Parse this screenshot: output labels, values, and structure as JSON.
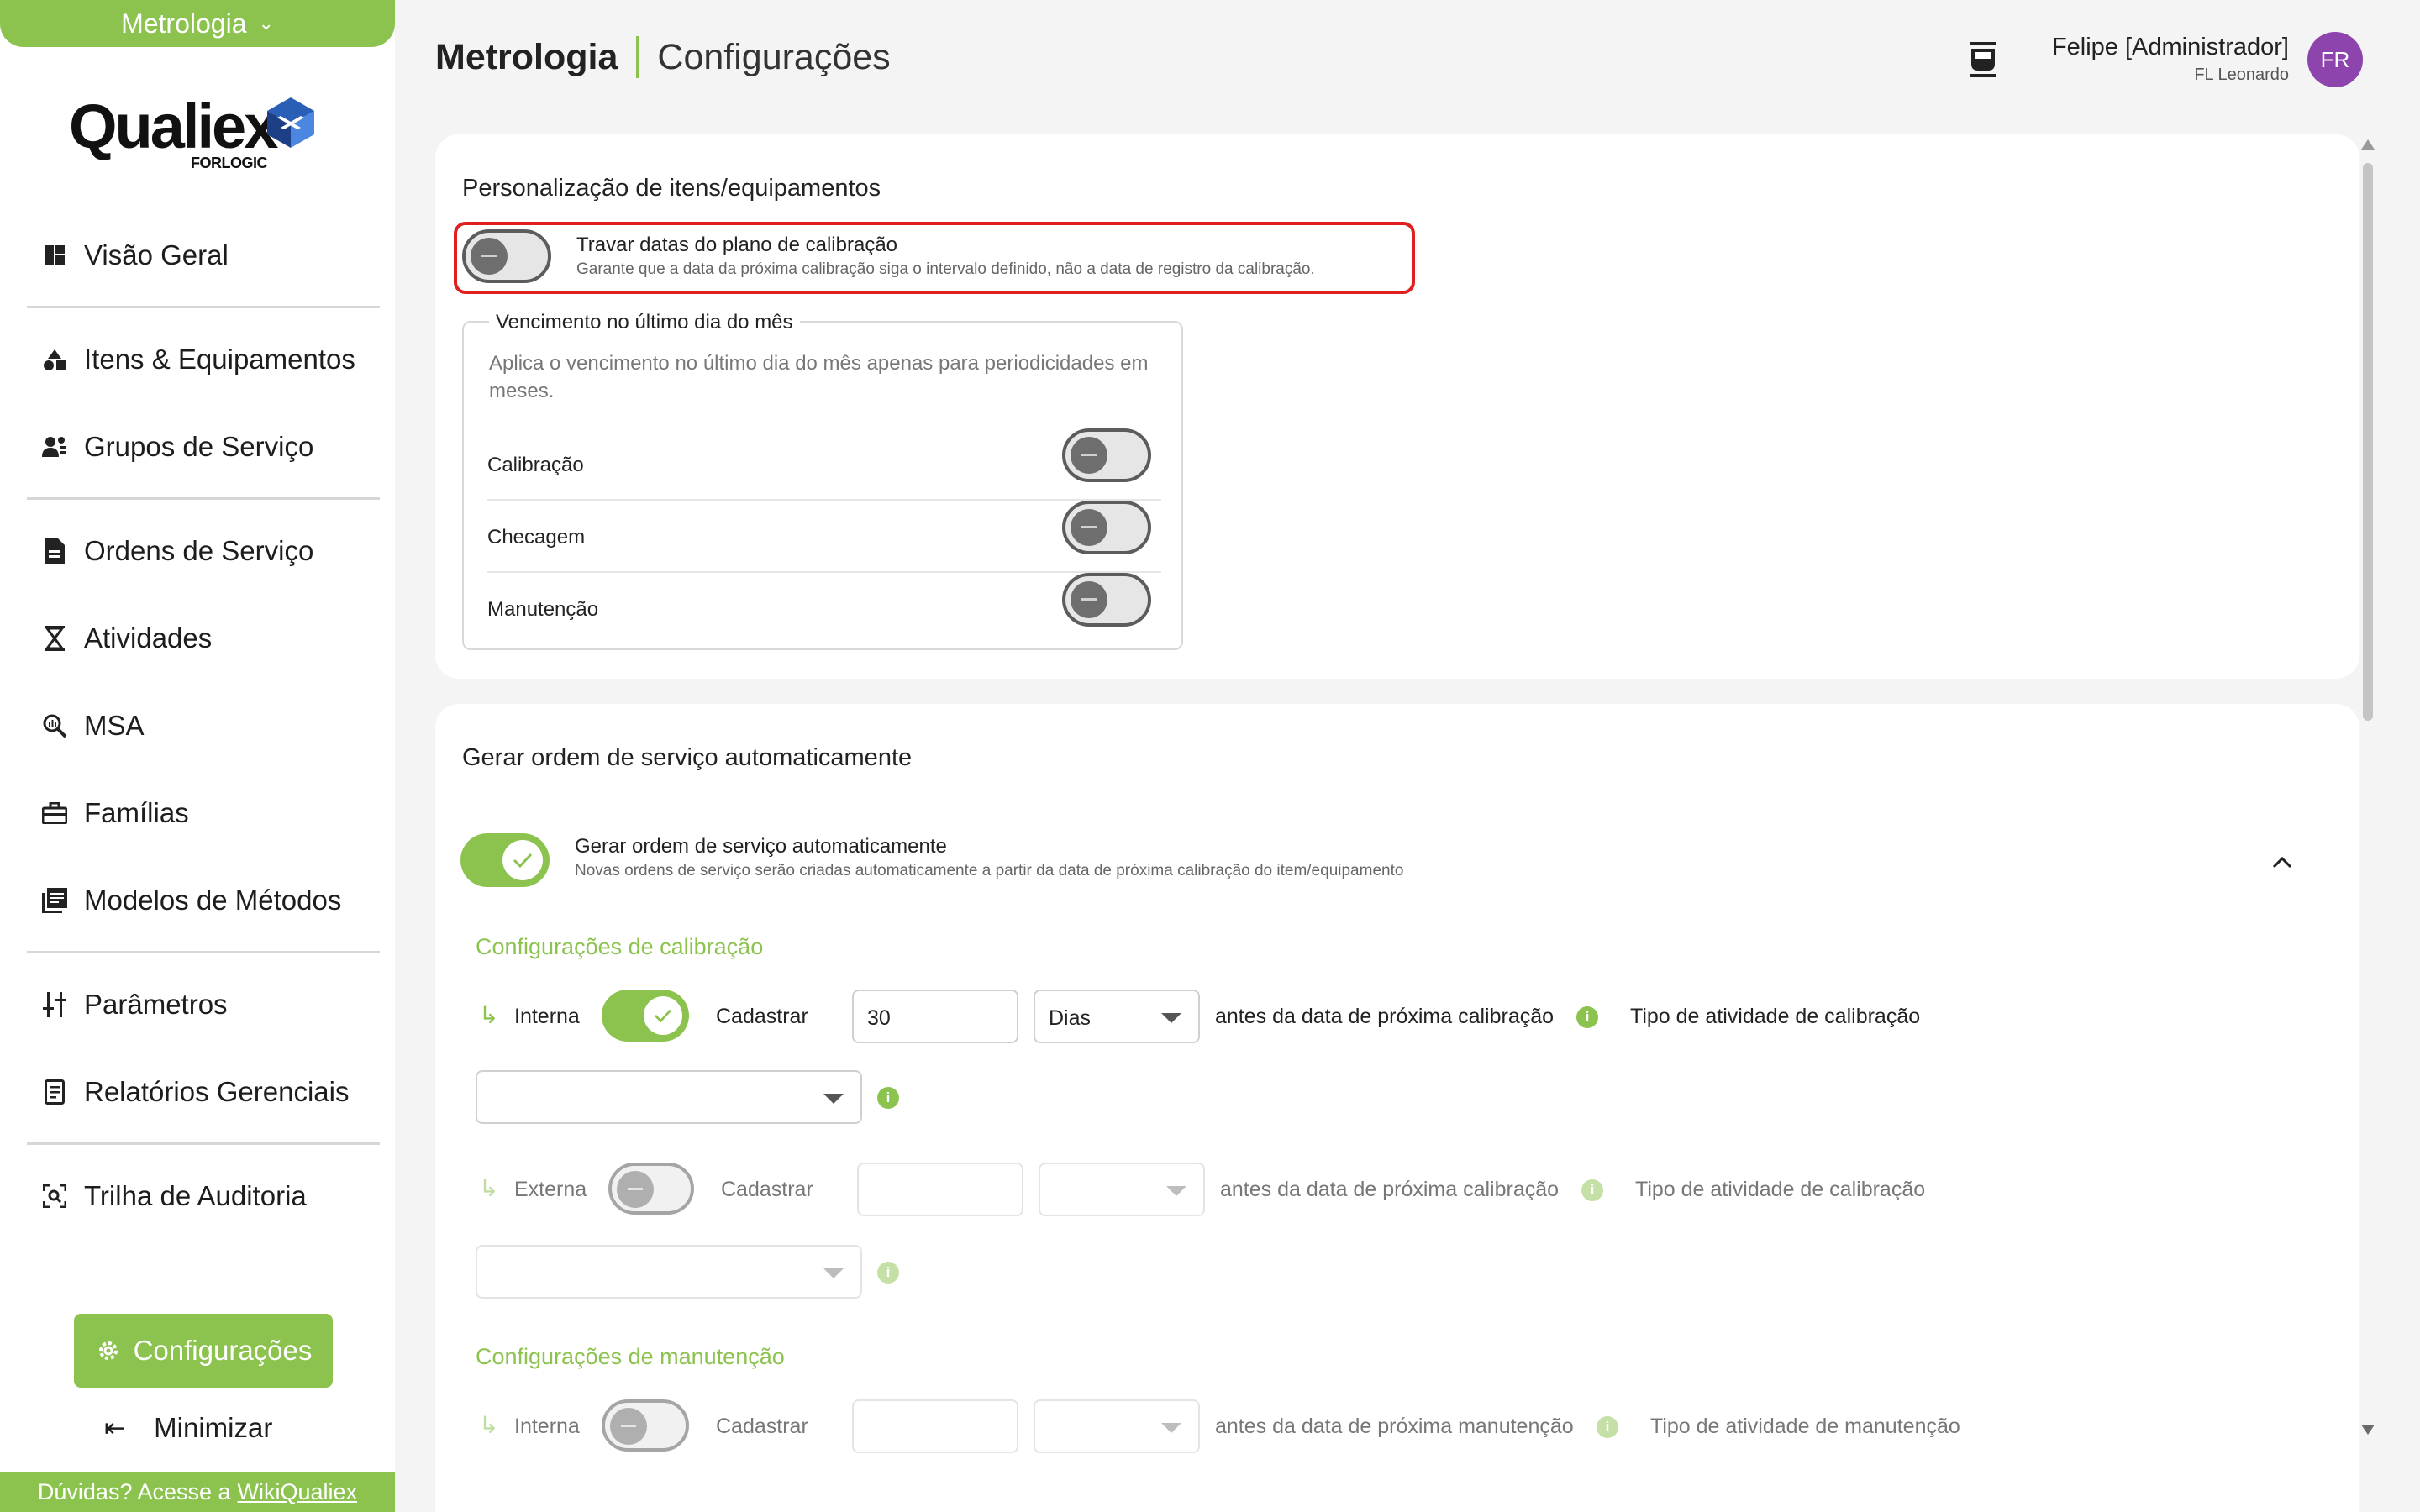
{
  "sidebar": {
    "module": "Metrologia",
    "logo": {
      "word": "Qualiex",
      "sub": "FORLOGIC"
    },
    "items": [
      {
        "label": "Visão Geral",
        "icon": "dashboard-icon"
      },
      {
        "label": "Itens & Equipamentos",
        "icon": "shapes-icon"
      },
      {
        "label": "Grupos de Serviço",
        "icon": "users-group-icon"
      },
      {
        "label": "Ordens de Serviço",
        "icon": "document-icon"
      },
      {
        "label": "Atividades",
        "icon": "hourglass-icon"
      },
      {
        "label": "MSA",
        "icon": "search-analytics-icon"
      },
      {
        "label": "Famílias",
        "icon": "toolbox-icon"
      },
      {
        "label": "Modelos de Métodos",
        "icon": "library-icon"
      },
      {
        "label": "Parâmetros",
        "icon": "sliders-icon"
      },
      {
        "label": "Relatórios Gerenciais",
        "icon": "report-icon"
      },
      {
        "label": "Trilha de Auditoria",
        "icon": "audit-scan-icon"
      }
    ],
    "config_button": "Configurações",
    "minimize": "Minimizar",
    "help_text": "Dúvidas? Acesse a",
    "help_link": "WikiQualiex"
  },
  "header": {
    "module": "Metrologia",
    "page": "Configurações",
    "user_name": "Felipe [Administrador]",
    "user_org": "FL Leonardo",
    "avatar": "FR"
  },
  "card1": {
    "title": "Personalização de itens/equipamentos",
    "lock_label": "Travar datas do plano de calibração",
    "lock_desc": "Garante que a data da próxima calibração siga o intervalo definido, não a data de registro da calibração.",
    "lock_on": false,
    "fieldset_legend": "Vencimento no último dia do mês",
    "fieldset_desc": "Aplica o vencimento no último dia do mês apenas para periodicidades em meses.",
    "rows": [
      {
        "label": "Calibração",
        "on": false
      },
      {
        "label": "Checagem",
        "on": false
      },
      {
        "label": "Manutenção",
        "on": false
      }
    ]
  },
  "card2": {
    "title": "Gerar ordem de serviço automaticamente",
    "auto_label": "Gerar ordem de serviço automaticamente",
    "auto_desc": "Novas ordens de serviço serão criadas automaticamente a partir da data de próxima calibração do item/equipamento",
    "auto_on": true,
    "calib_section": "Configurações de calibração",
    "calib_internal": {
      "type": "Interna",
      "register": "Cadastrar",
      "days": "30",
      "unit": "Dias",
      "before": "antes da data de próxima calibração",
      "activity_label": "Tipo de atividade de calibração",
      "on": true
    },
    "calib_external": {
      "type": "Externa",
      "register": "Cadastrar",
      "days": "",
      "unit": "",
      "before": "antes da data de próxima calibração",
      "activity_label": "Tipo de atividade de calibração",
      "on": false
    },
    "maint_section": "Configurações de manutenção",
    "maint_internal": {
      "type": "Interna",
      "register": "Cadastrar",
      "days": "",
      "unit": "",
      "before": "antes da data de próxima manutenção",
      "activity_label": "Tipo de atividade de manutenção",
      "on": false
    }
  },
  "colors": {
    "accent": "#8cc34f",
    "highlight": "#e11f1f",
    "avatar": "#8e44ad"
  }
}
